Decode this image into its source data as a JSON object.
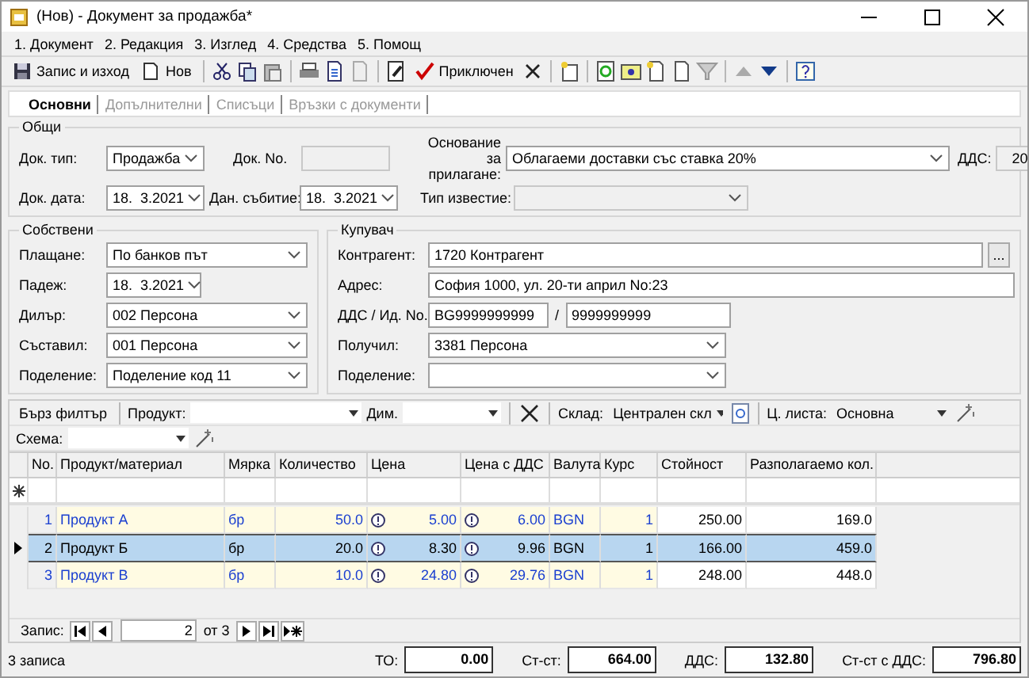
{
  "window": {
    "title": "(Нов) - Документ за продажба*"
  },
  "menu": [
    {
      "label": "1. Документ"
    },
    {
      "label": "2. Редакция"
    },
    {
      "label": "3. Изглед"
    },
    {
      "label": "4. Средства"
    },
    {
      "label": "5. Помощ"
    }
  ],
  "toolbar": {
    "save": "Запис и изход",
    "new": "Нов",
    "finish": "Приключен"
  },
  "tabs": [
    {
      "label": "Основни",
      "selected": true
    },
    {
      "label": "Допълнителни",
      "selected": false
    },
    {
      "label": "Списъци",
      "selected": false
    },
    {
      "label": "Връзки с документи",
      "selected": false
    }
  ],
  "general": {
    "title": "Общи",
    "doc_type": {
      "label": "Док. тип:",
      "value": "Продажба"
    },
    "doc_no": {
      "label": "Док. No."
    },
    "basis": {
      "label": "Основание за прилагане:",
      "value": "Облагаеми доставки със ставка 20%"
    },
    "vat": {
      "label": "ДДС:",
      "value": "20"
    },
    "doc_date": {
      "label": "Док. дата:",
      "value": "18.  3.2021"
    },
    "tax_event": {
      "label": "Дан. събитие:",
      "value": "18.  3.2021"
    },
    "notice_type": {
      "label": "Тип известие:"
    }
  },
  "own": {
    "title": "Собствени",
    "fields": [
      {
        "label": "Плащане:",
        "value": "По банков път",
        "kind": "combo"
      },
      {
        "label": "Падеж:",
        "value": "18.  3.2021",
        "kind": "date"
      },
      {
        "label": "Дилър:",
        "value": "002 Персона",
        "kind": "combo"
      },
      {
        "label": "Съставил:",
        "value": "001 Персона",
        "kind": "combo"
      },
      {
        "label": "Поделение:",
        "value": "Поделение код 11",
        "kind": "combo"
      }
    ]
  },
  "buyer": {
    "title": "Купувач",
    "contractor": {
      "label": "Контрагент:",
      "value": "1720 Контрагент",
      "button": "..."
    },
    "address": {
      "label": "Адрес:",
      "value": "София 1000, ул. 20-ти април No:23"
    },
    "vat_id": {
      "label": "ДДС / Ид. No.",
      "value": "BG9999999999",
      "separator": "/",
      "id_value": "9999999999"
    },
    "receiver": {
      "label": "Получил:",
      "value": "3381 Персона"
    },
    "division": {
      "label": "Поделение:"
    }
  },
  "filter": {
    "quick": "Бърз филтър",
    "product": "Продукт:",
    "dim": "Дим.",
    "warehouse": "Склад:",
    "warehouse_value": "Централен скл",
    "price_list": "Ц. листа:",
    "price_list_value": "Основна",
    "scheme": "Схема:"
  },
  "table": {
    "columns": [
      "No.",
      "Продукт/материал",
      "Мярка",
      "Количество",
      "Цена",
      "Цена с ДДС",
      "Валута",
      "Курс",
      "Стойност",
      "Разполагаемо кол."
    ],
    "rows": [
      {
        "no": "1",
        "product": "Продукт А",
        "unit": "бр",
        "qty": "50.0",
        "price": "5.00",
        "price_vat": "6.00",
        "currency": "BGN",
        "rate": "1",
        "value": "250.00",
        "available": "169.0",
        "selected": false
      },
      {
        "no": "2",
        "product": "Продукт Б",
        "unit": "бр",
        "qty": "20.0",
        "price": "8.30",
        "price_vat": "9.96",
        "currency": "BGN",
        "rate": "1",
        "value": "166.00",
        "available": "459.0",
        "selected": true
      },
      {
        "no": "3",
        "product": "Продукт В",
        "unit": "бр",
        "qty": "10.0",
        "price": "24.80",
        "price_vat": "29.76",
        "currency": "BGN",
        "rate": "1",
        "value": "248.00",
        "available": "448.0",
        "selected": false
      }
    ]
  },
  "navigator": {
    "label": "Запис:",
    "current": "2",
    "of": "от 3"
  },
  "status": {
    "records": "3 записа",
    "totals": [
      {
        "label": "ТО:",
        "value": "0.00"
      },
      {
        "label": "Ст-ст:",
        "value": "664.00"
      },
      {
        "label": "ДДС:",
        "value": "132.80"
      },
      {
        "label": "Ст-ст с ДДС:",
        "value": "796.80"
      }
    ]
  }
}
